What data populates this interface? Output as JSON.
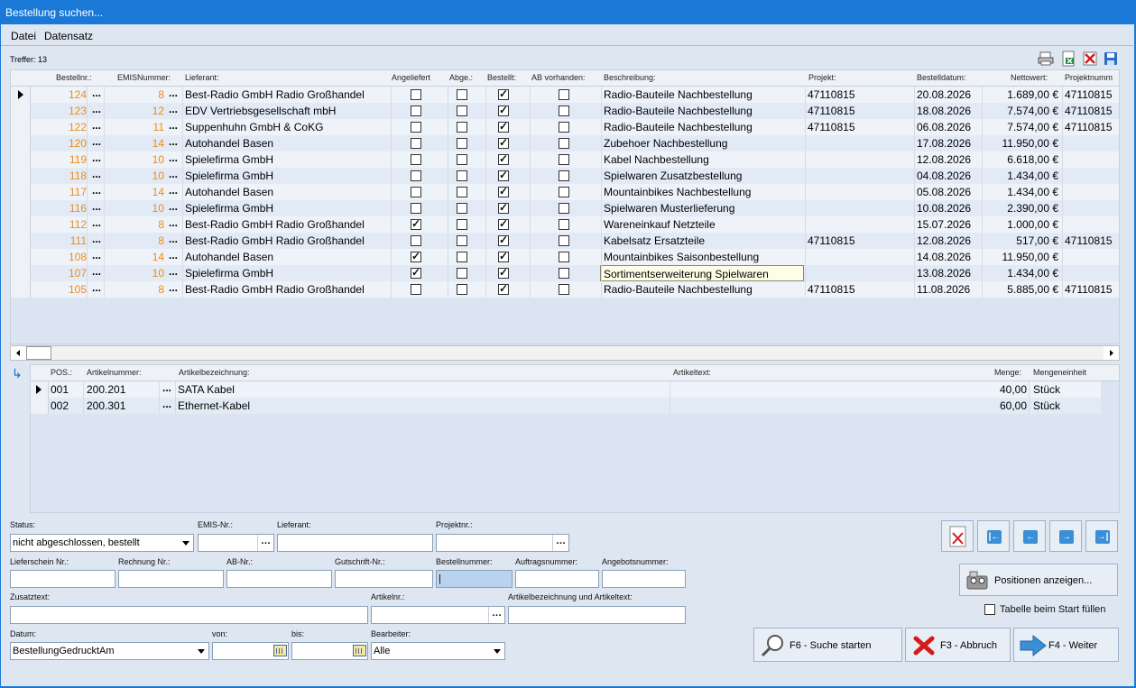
{
  "window": {
    "title": "Bestellung suchen..."
  },
  "menu": {
    "items": [
      "Datei",
      "Datensatz"
    ]
  },
  "treffer": "Treffer: 13",
  "grid": {
    "columns": [
      "Bestellnr.:",
      "EMISNummer:",
      "Lieferant:",
      "Angeliefert",
      "Abge.:",
      "Bestellt:",
      "AB vorhanden:",
      "Beschreibung:",
      "Projekt:",
      "Bestelldatum:",
      "Nettowert:",
      "Projektnumm"
    ],
    "rows": [
      {
        "nr": "124",
        "emis": "8",
        "lieferant": "Best-Radio GmbH Radio Großhandel",
        "angeliefert": false,
        "abge": false,
        "bestellt": true,
        "ab": false,
        "beschreibung": "Radio-Bauteile Nachbestellung",
        "projekt": "47110815",
        "datum": "20.08.2026",
        "netto": "1.689,00 €",
        "projektnr": "47110815"
      },
      {
        "nr": "123",
        "emis": "12",
        "lieferant": "EDV Vertriebsgesellschaft mbH",
        "angeliefert": false,
        "abge": false,
        "bestellt": true,
        "ab": false,
        "beschreibung": "Radio-Bauteile Nachbestellung",
        "projekt": "47110815",
        "datum": "18.08.2026",
        "netto": "7.574,00 €",
        "projektnr": "47110815"
      },
      {
        "nr": "122",
        "emis": "11",
        "lieferant": "Suppenhuhn GmbH & CoKG",
        "angeliefert": false,
        "abge": false,
        "bestellt": true,
        "ab": false,
        "beschreibung": "Radio-Bauteile Nachbestellung",
        "projekt": "47110815",
        "datum": "06.08.2026",
        "netto": "7.574,00 €",
        "projektnr": "47110815"
      },
      {
        "nr": "120",
        "emis": "14",
        "lieferant": "Autohandel Basen",
        "angeliefert": false,
        "abge": false,
        "bestellt": true,
        "ab": false,
        "beschreibung": "Zubehoer Nachbestellung",
        "projekt": "",
        "datum": "17.08.2026",
        "netto": "11.950,00 €",
        "projektnr": ""
      },
      {
        "nr": "119",
        "emis": "10",
        "lieferant": "Spielefirma GmbH",
        "angeliefert": false,
        "abge": false,
        "bestellt": true,
        "ab": false,
        "beschreibung": "Kabel Nachbestellung",
        "projekt": "",
        "datum": "12.08.2026",
        "netto": "6.618,00 €",
        "projektnr": ""
      },
      {
        "nr": "118",
        "emis": "10",
        "lieferant": "Spielefirma GmbH",
        "angeliefert": false,
        "abge": false,
        "bestellt": true,
        "ab": false,
        "beschreibung": "Spielwaren Zusatzbestellung",
        "projekt": "",
        "datum": "04.08.2026",
        "netto": "1.434,00 €",
        "projektnr": ""
      },
      {
        "nr": "117",
        "emis": "14",
        "lieferant": "Autohandel Basen",
        "angeliefert": false,
        "abge": false,
        "bestellt": true,
        "ab": false,
        "beschreibung": "Mountainbikes Nachbestellung",
        "projekt": "",
        "datum": "05.08.2026",
        "netto": "1.434,00 €",
        "projektnr": ""
      },
      {
        "nr": "116",
        "emis": "10",
        "lieferant": "Spielefirma GmbH",
        "angeliefert": false,
        "abge": false,
        "bestellt": true,
        "ab": false,
        "beschreibung": "Spielwaren Musterlieferung",
        "projekt": "",
        "datum": "10.08.2026",
        "netto": "2.390,00 €",
        "projektnr": ""
      },
      {
        "nr": "112",
        "emis": "8",
        "lieferant": "Best-Radio GmbH Radio Großhandel",
        "angeliefert": true,
        "abge": false,
        "bestellt": true,
        "ab": false,
        "beschreibung": "Wareneinkauf Netzteile",
        "projekt": "",
        "datum": "15.07.2026",
        "netto": "1.000,00 €",
        "projektnr": ""
      },
      {
        "nr": "111",
        "emis": "8",
        "lieferant": "Best-Radio GmbH Radio Großhandel",
        "angeliefert": false,
        "abge": false,
        "bestellt": true,
        "ab": false,
        "beschreibung": "Kabelsatz Ersatzteile",
        "projekt": "47110815",
        "datum": "12.08.2026",
        "netto": "517,00 €",
        "projektnr": "47110815"
      },
      {
        "nr": "108",
        "emis": "14",
        "lieferant": "Autohandel Basen",
        "angeliefert": true,
        "abge": false,
        "bestellt": true,
        "ab": false,
        "beschreibung": "Mountainbikes Saisonbestellung",
        "projekt": "",
        "datum": "14.08.2026",
        "netto": "11.950,00 €",
        "projektnr": ""
      },
      {
        "nr": "107",
        "emis": "10",
        "lieferant": "Spielefirma GmbH",
        "angeliefert": true,
        "abge": false,
        "bestellt": true,
        "ab": false,
        "beschreibung": "Sortimentserweiterung Spielwaren",
        "projekt": "",
        "datum": "13.08.2026",
        "netto": "1.434,00 €",
        "projektnr": ""
      },
      {
        "nr": "105",
        "emis": "8",
        "lieferant": "Best-Radio GmbH Radio Großhandel",
        "angeliefert": false,
        "abge": false,
        "bestellt": true,
        "ab": false,
        "beschreibung": "Radio-Bauteile Nachbestellung",
        "projekt": "47110815",
        "datum": "11.08.2026",
        "netto": "5.885,00 €",
        "projektnr": "47110815"
      }
    ]
  },
  "detail": {
    "columns": [
      "POS.:",
      "Artikelnummer:",
      "Artikelbezeichnung:",
      "Artikeltext:",
      "Menge:",
      "Mengeneinheit"
    ],
    "rows": [
      {
        "pos": "001",
        "artnr": "200.201",
        "bez": "SATA Kabel",
        "text": "",
        "menge": "40,00",
        "einheit": "Stück"
      },
      {
        "pos": "002",
        "artnr": "200.301",
        "bez": "Ethernet-Kabel",
        "text": "",
        "menge": "60,00",
        "einheit": "Stück"
      }
    ]
  },
  "form": {
    "status_label": "Status:",
    "status_value": "nicht abgeschlossen, bestellt",
    "emis_label": "EMIS-Nr.:",
    "emis_value": "",
    "lieferant_label": "Lieferant:",
    "lieferant_value": "",
    "projektnr_label": "Projektnr.:",
    "projektnr_value": "",
    "lieferschein_label": "Lieferschein Nr.:",
    "rechnung_label": "Rechnung Nr.:",
    "ab_label": "AB-Nr.:",
    "gutschrift_label": "Gutschrift-Nr.:",
    "bestellnummer_label": "Bestellnummer:",
    "bestellnummer_value": "|",
    "auftragsnummer_label": "Auftragsnummer:",
    "angebotsnummer_label": "Angebotsnummer:",
    "zusatztext_label": "Zusatztext:",
    "artikelnr_label": "Artikelnr.:",
    "artikelbez_label": "Artikelbezeichnung und Artikeltext:",
    "datum_label": "Datum:",
    "datum_value": "BestellungGedrucktAm",
    "von_label": "von:",
    "von_value": "",
    "bis_label": "bis:",
    "bis_value": "",
    "bearbeiter_label": "Bearbeiter:",
    "bearbeiter_value": "Alle"
  },
  "buttons": {
    "positionen": "Positionen anzeigen...",
    "tabelle_beim_start": "Tabelle beim Start füllen",
    "tabelle_checked": false,
    "suche": "F6 - Suche starten",
    "abbruch": "F3 - Abbruch",
    "weiter": "F4 - Weiter"
  },
  "colors": {
    "titlebar": "#1a79d6",
    "number_accent": "#f08a18",
    "background": "#dde6f1"
  }
}
